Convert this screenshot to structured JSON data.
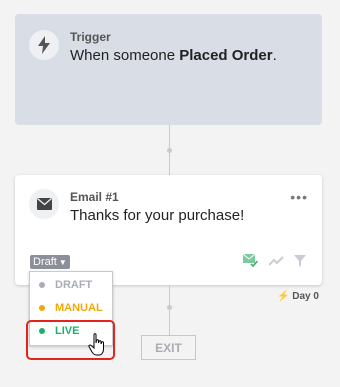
{
  "trigger": {
    "label": "Trigger",
    "text_prefix": "When someone ",
    "event": "Placed Order",
    "text_suffix": ".",
    "icon": "lightning-icon"
  },
  "email": {
    "label": "Email #1",
    "subject": "Thanks for your purchase!",
    "more_label": "•••",
    "status_label": "Draft",
    "icon": "envelope-icon"
  },
  "timing": {
    "day_label": "Day 0"
  },
  "status_menu": {
    "options": [
      {
        "label": "DRAFT",
        "color": "#a9adb5"
      },
      {
        "label": "MANUAL",
        "color": "#f0a80a"
      },
      {
        "label": "LIVE",
        "color": "#18b368"
      }
    ]
  },
  "exit_label": "EXIT",
  "colors": {
    "trigger_bg": "#d9dde6",
    "highlight": "#e2241e",
    "status_btn": "#8a8f99"
  }
}
